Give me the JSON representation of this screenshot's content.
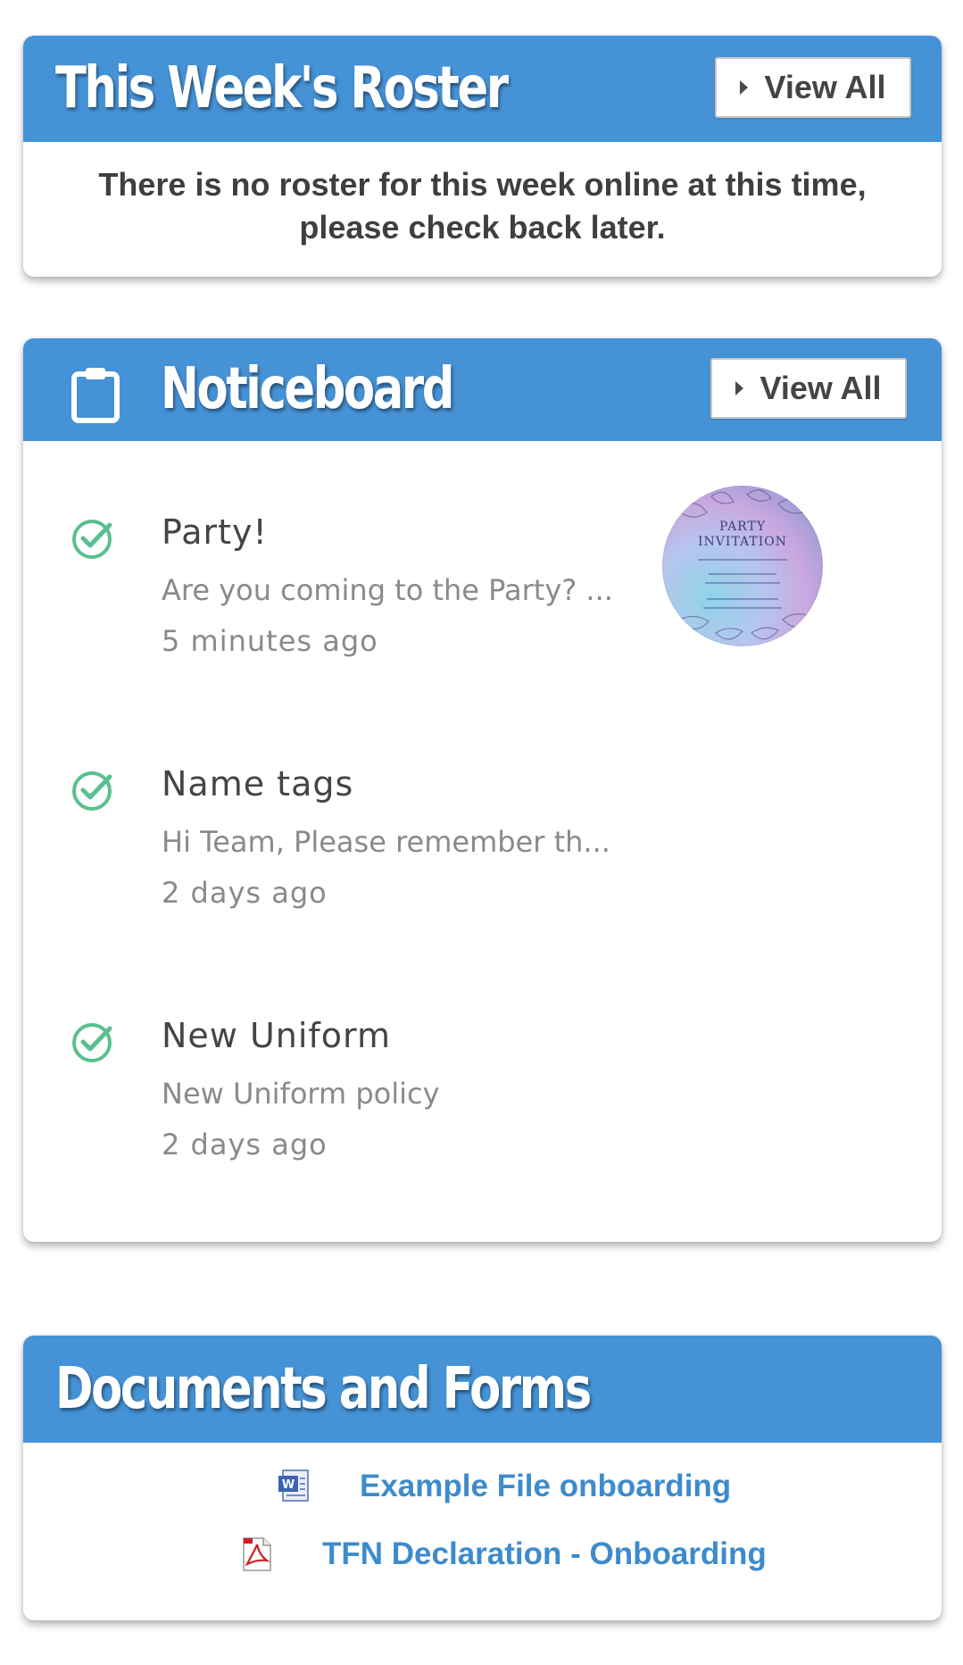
{
  "roster": {
    "title": "This Week's Roster",
    "view_all_label": "View All",
    "message": "There is no roster for this week online at this time, please check back later."
  },
  "noticeboard": {
    "title": "Noticeboard",
    "view_all_label": "View All",
    "items": [
      {
        "title": "Party!",
        "preview": "Are you coming to the Party? ...",
        "time": "5 minutes ago",
        "thumbnail": {
          "title_line1": "PARTY",
          "title_line2": "INVITATION"
        }
      },
      {
        "title": "Name tags",
        "preview": "Hi Team, Please remember th...",
        "time": "2 days ago"
      },
      {
        "title": "New Uniform",
        "preview": "New Uniform policy",
        "time": "2 days ago"
      }
    ]
  },
  "documents": {
    "title": "Documents and Forms",
    "files": [
      {
        "label": "Example File onboarding",
        "icon": "word-document-icon"
      },
      {
        "label": "TFN Declaration - Onboarding",
        "icon": "pdf-document-icon"
      }
    ]
  },
  "colors": {
    "header_blue": "#4592d6",
    "link_blue": "#3d8bcd",
    "check_green": "#5bbf8f"
  }
}
